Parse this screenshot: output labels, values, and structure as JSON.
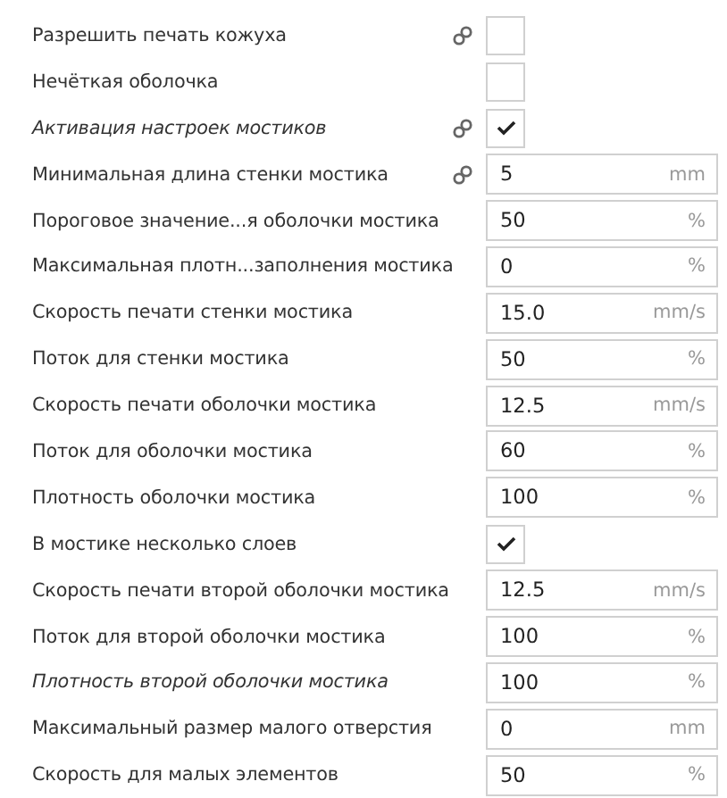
{
  "settings": [
    {
      "label": "Разрешить печать кожуха",
      "italic": false,
      "linked": true,
      "kind": "checkbox",
      "checked": false
    },
    {
      "label": "Нечёткая оболочка",
      "italic": false,
      "linked": false,
      "kind": "checkbox",
      "checked": false
    },
    {
      "label": "Активация настроек мостиков",
      "italic": true,
      "linked": true,
      "kind": "checkbox",
      "checked": true
    },
    {
      "label": "Минимальная длина стенки мостика",
      "italic": false,
      "linked": true,
      "kind": "number",
      "value": "5",
      "unit": "mm"
    },
    {
      "label": "Пороговое значение...я оболочки мостика",
      "italic": false,
      "linked": false,
      "kind": "number",
      "value": "50",
      "unit": "%"
    },
    {
      "label": "Максимальная плотн...заполнения мостика",
      "italic": false,
      "linked": false,
      "kind": "number",
      "value": "0",
      "unit": "%"
    },
    {
      "label": "Скорость печати стенки мостика",
      "italic": false,
      "linked": false,
      "kind": "number",
      "value": "15.0",
      "unit": "mm/s"
    },
    {
      "label": "Поток для стенки мостика",
      "italic": false,
      "linked": false,
      "kind": "number",
      "value": "50",
      "unit": "%"
    },
    {
      "label": "Скорость печати оболочки мостика",
      "italic": false,
      "linked": false,
      "kind": "number",
      "value": "12.5",
      "unit": "mm/s"
    },
    {
      "label": "Поток для оболочки мостика",
      "italic": false,
      "linked": false,
      "kind": "number",
      "value": "60",
      "unit": "%"
    },
    {
      "label": "Плотность оболочки мостика",
      "italic": false,
      "linked": false,
      "kind": "number",
      "value": "100",
      "unit": "%"
    },
    {
      "label": "В мостике несколько слоев",
      "italic": false,
      "linked": false,
      "kind": "checkbox",
      "checked": true
    },
    {
      "label": "Скорость печати второй оболочки мостика",
      "italic": false,
      "linked": false,
      "kind": "number",
      "value": "12.5",
      "unit": "mm/s"
    },
    {
      "label": "Поток для второй оболочки мостика",
      "italic": false,
      "linked": false,
      "kind": "number",
      "value": "100",
      "unit": "%"
    },
    {
      "label": "Плотность второй оболочки мостика",
      "italic": true,
      "linked": false,
      "kind": "number",
      "value": "100",
      "unit": "%"
    },
    {
      "label": "Максимальный размер малого отверстия",
      "italic": false,
      "linked": false,
      "kind": "number",
      "value": "0",
      "unit": "mm"
    },
    {
      "label": "Скорость для малых элементов",
      "italic": false,
      "linked": false,
      "kind": "number",
      "value": "50",
      "unit": "%"
    }
  ]
}
